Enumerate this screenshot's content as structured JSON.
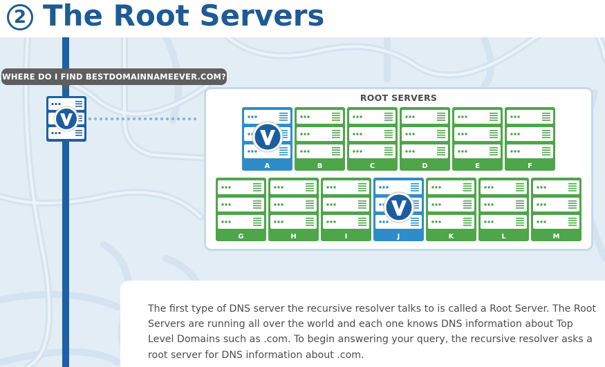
{
  "header": {
    "step_number": "2",
    "title": "The Root Servers"
  },
  "query": {
    "text": "WHERE DO I FIND BESTDOMAINNAMEEVER.COM?"
  },
  "root_servers": {
    "title": "ROOT SERVERS",
    "top_row": [
      "A",
      "B",
      "C",
      "D",
      "E",
      "F"
    ],
    "bottom_row": [
      "G",
      "H",
      "I",
      "J",
      "K",
      "L",
      "M"
    ],
    "highlighted": [
      "A",
      "J"
    ],
    "colors": {
      "green": "#4ea54a",
      "blue": "#2e8dc9",
      "dark_blue": "#1c60a5"
    }
  },
  "description": "The first type of DNS server the recursive resolver talks to is called a Root Server. The Root Servers are running all over the world and each one knows DNS information about Top Level Domains such as .com. To begin answering your query, the recursive resolver asks a root server for DNS information about .com."
}
